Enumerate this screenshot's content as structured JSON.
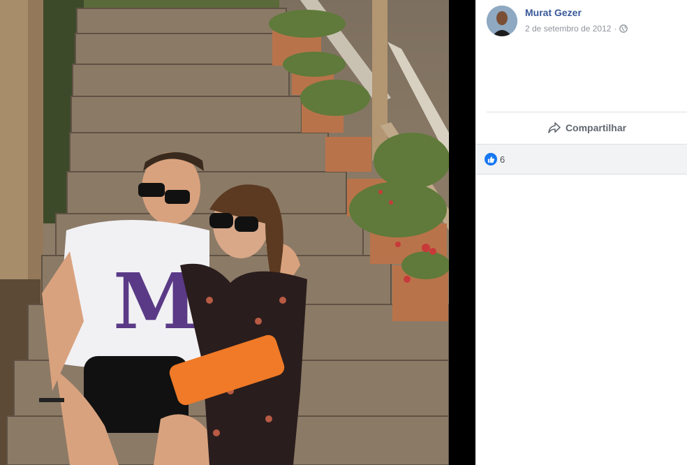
{
  "post": {
    "author_name": "Murat Gezer",
    "date": "2 de setembro de 2012",
    "separator": "·",
    "privacy_icon": "globe-icon"
  },
  "actions": {
    "share_label": "Compartilhar",
    "share_icon": "share-arrow-icon"
  },
  "reactions": {
    "like_icon": "thumbs-up-icon",
    "count": "6"
  },
  "colors": {
    "author_link": "#385898",
    "like_blue": "#1877f2",
    "reactions_bg": "#f2f3f5",
    "viewer_gap": "#000000"
  }
}
